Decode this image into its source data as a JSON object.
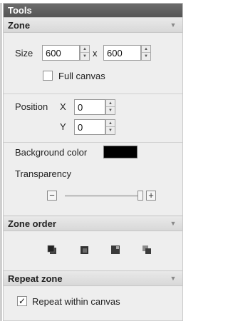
{
  "panel": {
    "title": "Tools"
  },
  "zone": {
    "header": "Zone",
    "size_label": "Size",
    "width_value": "600",
    "separator_x": "x",
    "height_value": "600",
    "full_canvas_label": "Full canvas",
    "full_canvas_checked": false,
    "position_label": "Position",
    "x_label": "X",
    "x_value": "0",
    "y_label": "Y",
    "y_value": "0",
    "background_color_label": "Background color",
    "background_color": "#000000",
    "transparency_label": "Transparency",
    "transparency_level": 1.0,
    "minus_glyph": "−",
    "plus_glyph": "+"
  },
  "zone_order": {
    "header": "Zone order",
    "buttons": [
      "bring-to-front-icon",
      "bring-forward-icon",
      "send-backward-icon",
      "send-to-back-icon"
    ]
  },
  "repeat_zone": {
    "header": "Repeat zone",
    "repeat_label": "Repeat within canvas",
    "repeat_checked": true,
    "check_glyph": "✓"
  },
  "glyphs": {
    "caret": "▼",
    "spin_up": "▲",
    "spin_down": "▼"
  }
}
